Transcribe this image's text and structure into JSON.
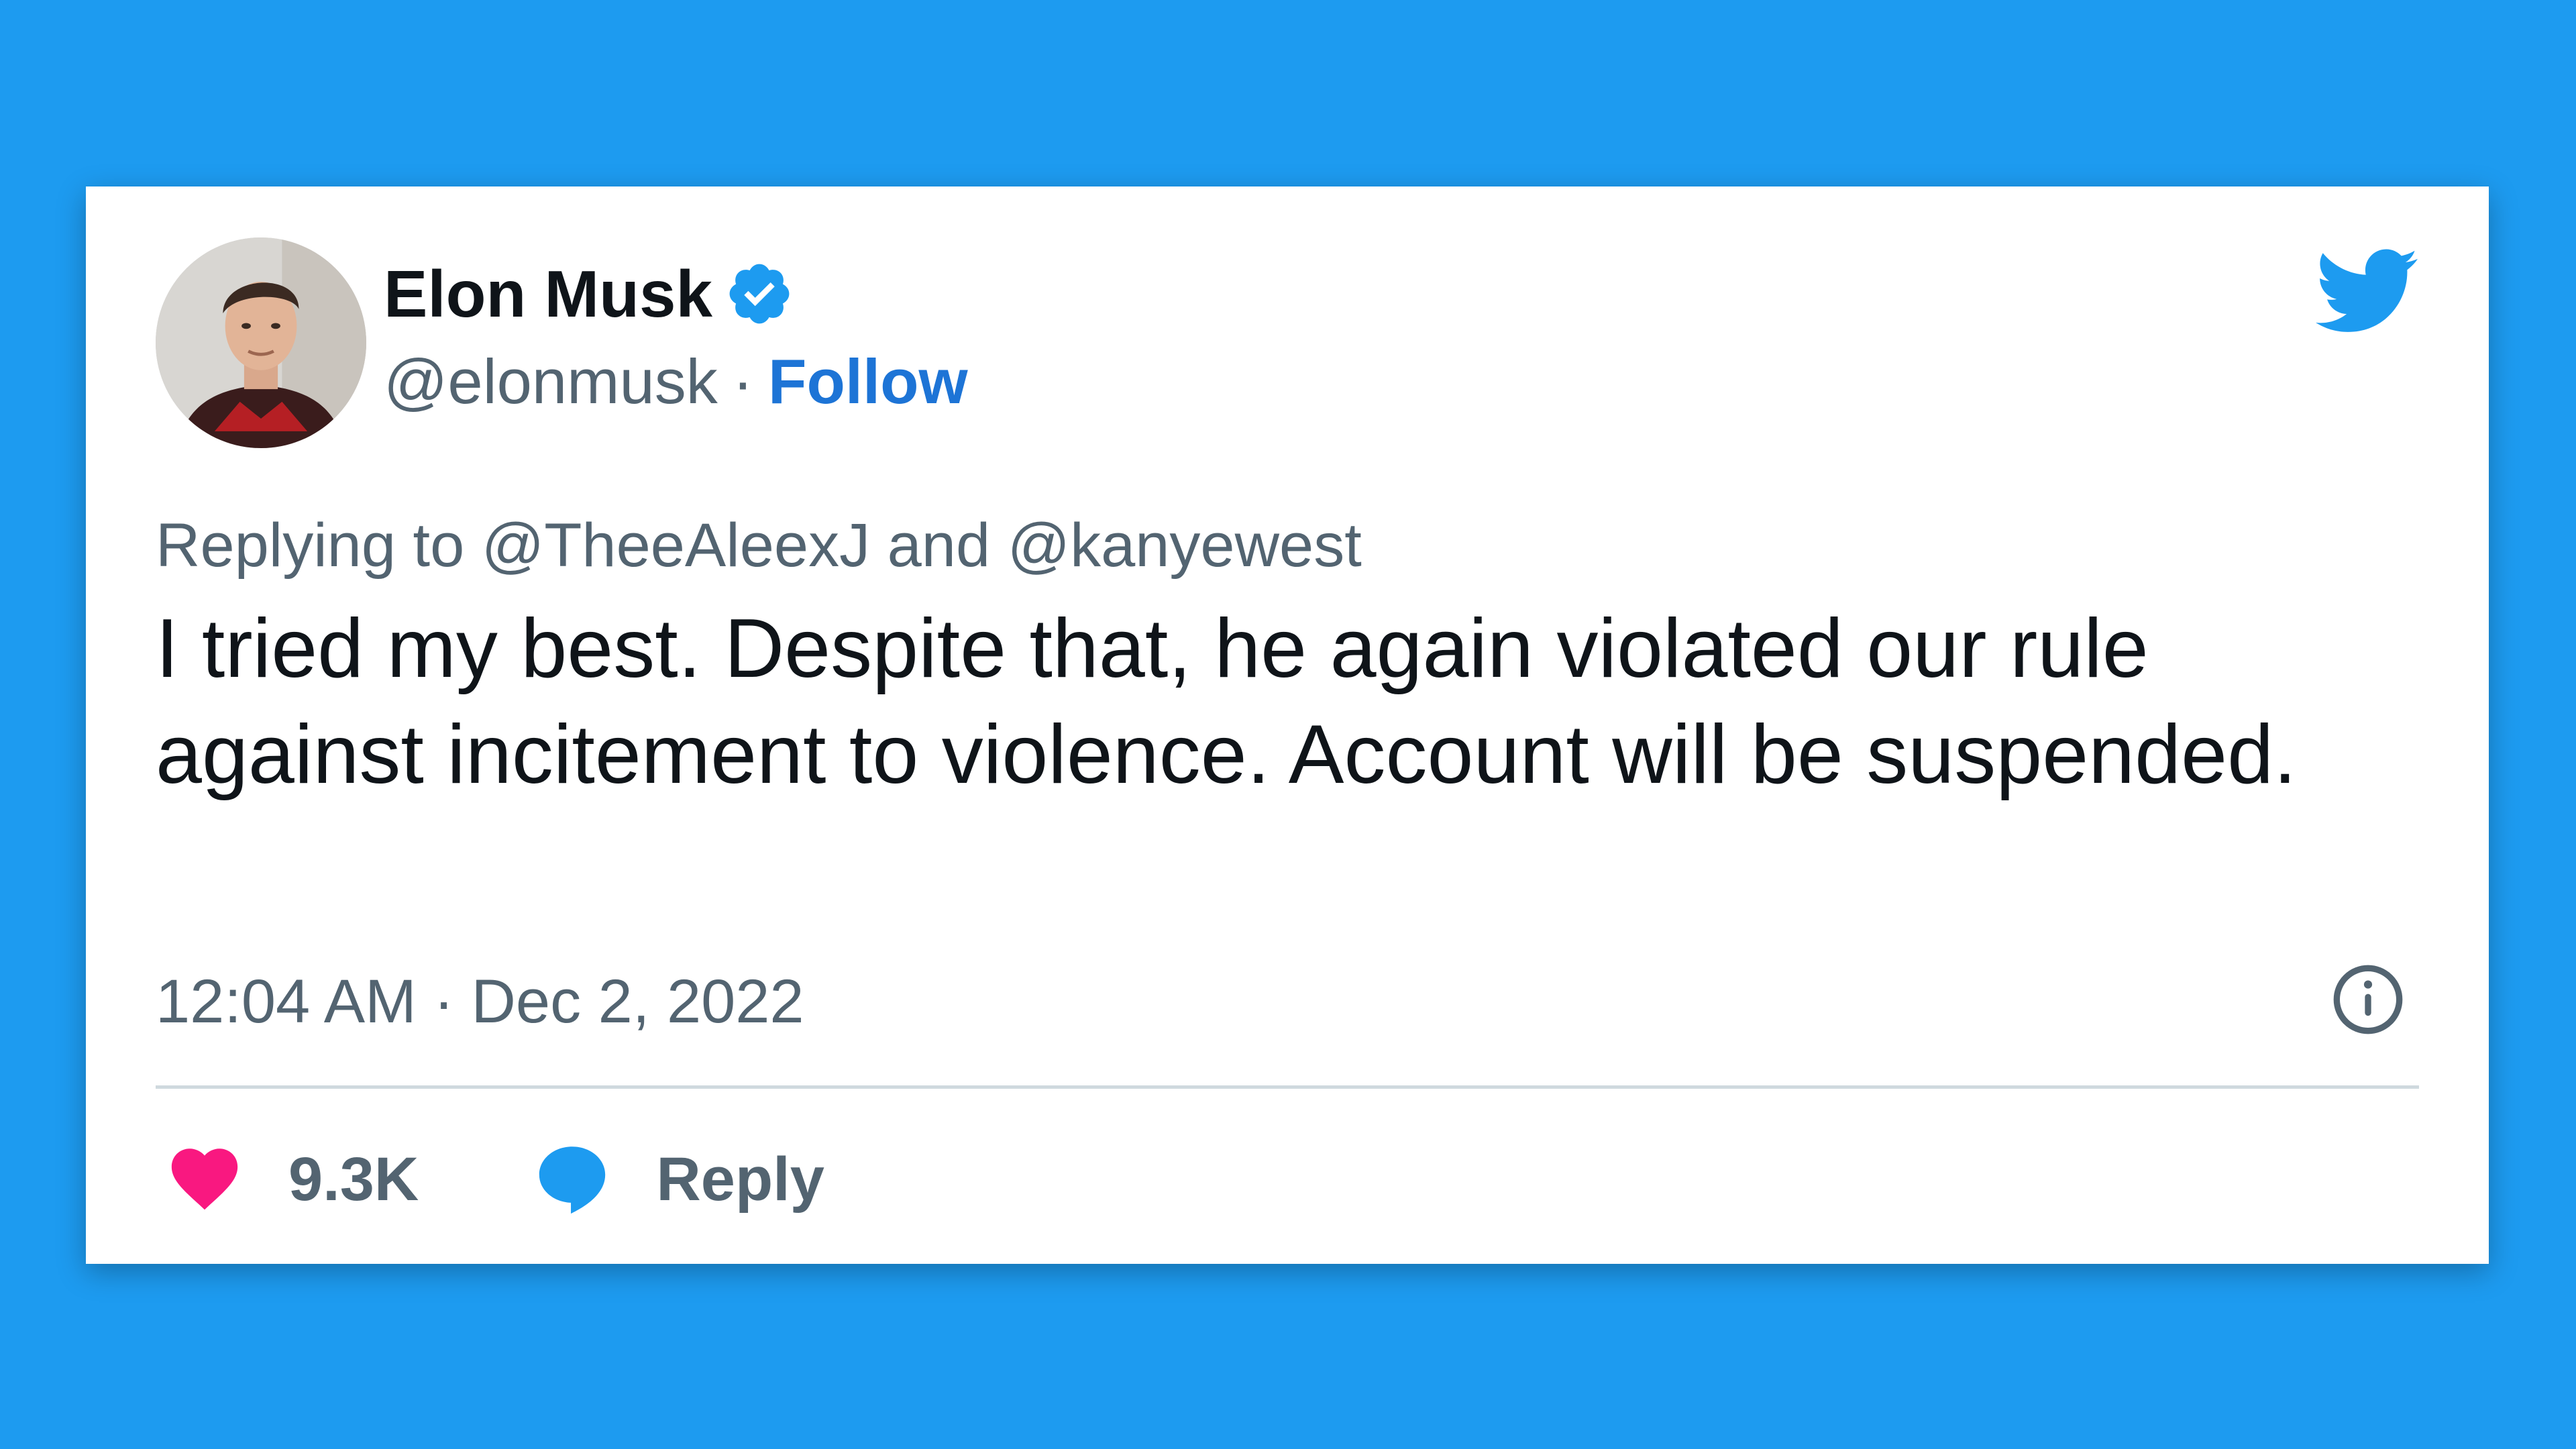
{
  "colors": {
    "background": "#1d9bf0",
    "twitter_blue": "#1d9bf0",
    "follow_link": "#1d74d6",
    "like_heart": "#f91880",
    "secondary_text": "#536471",
    "primary_text": "#0f1419"
  },
  "tweet": {
    "author": {
      "name": "Elon Musk",
      "handle": "@elonmusk",
      "verified_icon": "verified-badge-icon",
      "avatar": "profile-photo"
    },
    "separator": "·",
    "follow_label": "Follow",
    "brand_icon": "twitter-bird-icon",
    "replying_prefix": "Replying to",
    "reply_to": [
      "@TheeAleexJ",
      "@kanyewest"
    ],
    "reply_join": "and",
    "text": "I tried my best. Despite that, he again violated our rule against incitement to violence. Account will be suspended.",
    "time": "12:04 AM",
    "date": "Dec 2, 2022",
    "info_icon": "info-icon",
    "likes": "9.3K",
    "like_icon": "heart-icon",
    "reply_icon": "speech-bubble-icon",
    "reply_label": "Reply"
  }
}
